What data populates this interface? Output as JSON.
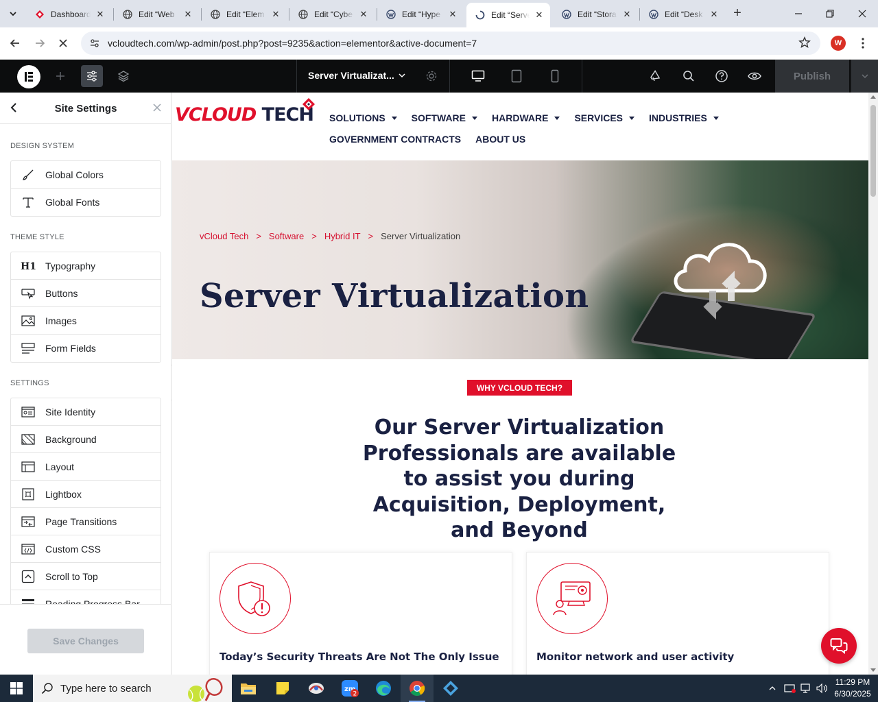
{
  "browser": {
    "tabs": [
      {
        "label": "Dashboard",
        "icon": "vcloud-icon"
      },
      {
        "label": "Edit “Web",
        "icon": "globe-icon"
      },
      {
        "label": "Edit “Elem",
        "icon": "globe-icon"
      },
      {
        "label": "Edit “Cybe",
        "icon": "globe-icon"
      },
      {
        "label": "Edit “Hype",
        "icon": "wordpress-icon"
      },
      {
        "label": "Edit “Serve",
        "icon": "loading-icon"
      },
      {
        "label": "Edit “Stora",
        "icon": "wordpress-icon"
      },
      {
        "label": "Edit “Desk",
        "icon": "wordpress-icon"
      }
    ],
    "url": "vcloudtech.com/wp-admin/post.php?post=9235&action=elementor&active-document=7",
    "profile_initial": "W"
  },
  "editor": {
    "document_title": "Server Virtualizat...",
    "publish_label": "Publish"
  },
  "panel": {
    "title": "Site Settings",
    "sections": [
      {
        "title": "DESIGN SYSTEM",
        "items": [
          {
            "label": "Global Colors",
            "icon": "brush-icon"
          },
          {
            "label": "Global Fonts",
            "icon": "font-icon"
          }
        ]
      },
      {
        "title": "THEME STYLE",
        "items": [
          {
            "label": "Typography",
            "icon": "heading-icon"
          },
          {
            "label": "Buttons",
            "icon": "button-icon"
          },
          {
            "label": "Images",
            "icon": "image-icon"
          },
          {
            "label": "Form Fields",
            "icon": "form-icon"
          }
        ]
      },
      {
        "title": "SETTINGS",
        "items": [
          {
            "label": "Site Identity",
            "icon": "site-identity-icon"
          },
          {
            "label": "Background",
            "icon": "background-icon"
          },
          {
            "label": "Layout",
            "icon": "layout-icon"
          },
          {
            "label": "Lightbox",
            "icon": "lightbox-icon"
          },
          {
            "label": "Page Transitions",
            "icon": "transition-icon"
          },
          {
            "label": "Custom CSS",
            "icon": "code-icon"
          },
          {
            "label": "Scroll to Top",
            "icon": "scroll-top-icon"
          },
          {
            "label": "Reading Progress Bar",
            "icon": "progress-bar-icon"
          }
        ]
      }
    ],
    "save_label": "Save Changes"
  },
  "site": {
    "logo": {
      "brand_a": "VCLOUD",
      "brand_b": "TECH"
    },
    "nav_row1": [
      "SOLUTIONS",
      "SOFTWARE",
      "HARDWARE",
      "SERVICES",
      "INDUSTRIES"
    ],
    "nav_row2": [
      "GOVERNMENT CONTRACTS",
      "ABOUT US"
    ],
    "breadcrumb": {
      "items": [
        "vCloud Tech",
        "Software",
        "Hybrid IT"
      ],
      "separator": ">",
      "current": "Server Virtualization"
    },
    "hero_title": "Server Virtualization",
    "why_badge": "WHY VCLOUD TECH?",
    "heading": "Our Server Virtualization Professionals are available to assist you during Acquisition, Deployment, and Beyond",
    "cards": [
      {
        "title": "Today’s Security Threats Are Not The Only Issue",
        "icon": "shield-alert-icon"
      },
      {
        "title": "Monitor network and user activity",
        "icon": "monitor-user-icon"
      }
    ]
  },
  "taskbar": {
    "search_placeholder": "Type here to search",
    "time": "11:29 PM",
    "date": "6/30/2025",
    "zoom_badge": "2"
  },
  "colors": {
    "accent": "#e0102b",
    "navy": "#1a2142",
    "editor_bar": "#0c0d0e"
  }
}
